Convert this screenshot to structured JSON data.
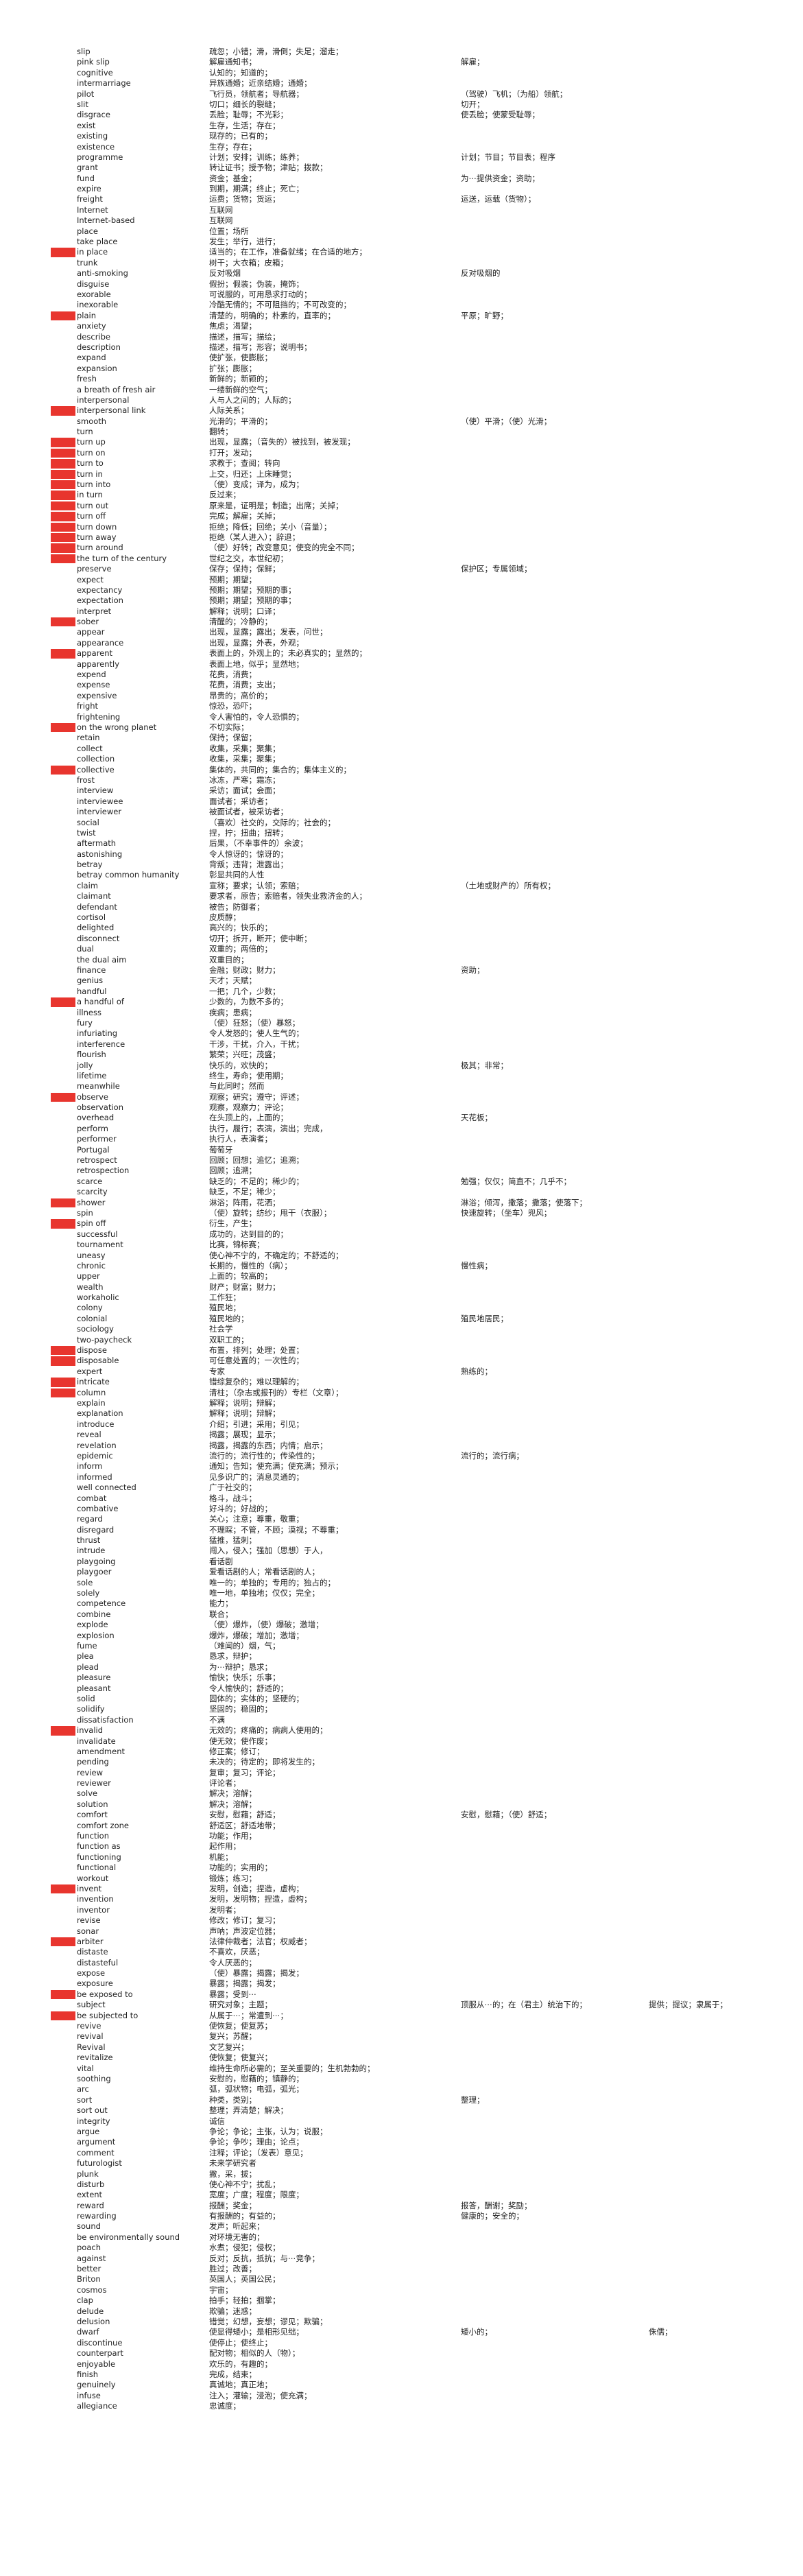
{
  "highlight_color": "#e8352e",
  "entries": [
    {
      "w": "slip",
      "d1": "疏忽；小错；滑，滑倒；失足；溜走；"
    },
    {
      "w": "pink slip",
      "d1": "解雇通知书；",
      "d2": "解雇；"
    },
    {
      "w": "cognitive",
      "d1": "认知的；知道的；"
    },
    {
      "w": "intermarriage",
      "d1": "异族通婚；近亲结婚；通婚；"
    },
    {
      "w": "pilot",
      "d1": "飞行员，领航者；导航器；",
      "d2": "（驾驶）飞机；（为船）领航；"
    },
    {
      "w": "slit",
      "d1": "切口；细长的裂缝；",
      "d2": "切开；"
    },
    {
      "w": "disgrace",
      "d1": "丢脸；耻辱；不光彩；",
      "d2": "使丢脸；使蒙受耻辱；"
    },
    {
      "w": "exist",
      "d1": "生存，生活；存在；"
    },
    {
      "w": "existing",
      "d1": "现存的；已有的；"
    },
    {
      "w": "existence",
      "d1": "生存；存在；"
    },
    {
      "w": "programme",
      "d1": "计划；安排；训练；练养；",
      "d2": "计划；节目；节目表；程序"
    },
    {
      "w": "grant",
      "d1": "转让证书；授予物；津贴；拨款；"
    },
    {
      "w": "fund",
      "d1": "资金；基金；",
      "d2": "为⋯提供资金；资助；"
    },
    {
      "w": "expire",
      "d1": "到期，期满；终止；死亡；"
    },
    {
      "w": "freight",
      "d1": "运费；货物；货运；",
      "d2": "运送，运载（货物）；"
    },
    {
      "w": "Internet",
      "d1": "互联网"
    },
    {
      "w": "Internet-based",
      "d1": "互联网"
    },
    {
      "w": "place",
      "d1": "位置；场所"
    },
    {
      "w": "take place",
      "d1": "发生；举行，进行；"
    },
    {
      "w": "in place",
      "d1": "适当的；在工作，准备就绪；在合适的地方；",
      "hl": true
    },
    {
      "w": "trunk",
      "d1": "树干；大衣箱；皮箱；"
    },
    {
      "w": "anti-smoking",
      "d1": "反对吸烟",
      "d2": "反对吸烟的"
    },
    {
      "w": "disguise",
      "d1": "假扮；假装；伪装，掩饰；"
    },
    {
      "w": "exorable",
      "d1": "可说服的，可用恳求打动的；"
    },
    {
      "w": "inexorable",
      "d1": "冷酷无情的；不可阻挡的；不可改变的；"
    },
    {
      "w": "plain",
      "d1": "清楚的，明确的；朴素的，直率的；",
      "d2": "平原；旷野；",
      "hl": true
    },
    {
      "w": "anxiety",
      "d1": "焦虑；渴望；"
    },
    {
      "w": "describe",
      "d1": "描述，描写；描绘；"
    },
    {
      "w": "description",
      "d1": "描述，描写；形容；说明书；"
    },
    {
      "w": "expand",
      "d1": "使扩张，使膨胀；"
    },
    {
      "w": "expansion",
      "d1": "扩张；膨胀；"
    },
    {
      "w": "fresh",
      "d1": "新鲜的；新颖的；"
    },
    {
      "w": "a breath of fresh air",
      "d1": "一缕新鲜的空气；"
    },
    {
      "w": "interpersonal",
      "d1": "人与人之间的；人际的；"
    },
    {
      "w": "interpersonal link",
      "d1": "人际关系；",
      "hl": true
    },
    {
      "w": "smooth",
      "d1": "光滑的；平滑的；",
      "d2": "（使）平滑；（使）光滑；"
    },
    {
      "w": "turn",
      "d1": "翻转；"
    },
    {
      "w": "turn up",
      "d1": "出现，显露；（音失的）被找到，被发现；",
      "hl": true
    },
    {
      "w": "turn on",
      "d1": "打开；发动；",
      "hl": true
    },
    {
      "w": "turn to",
      "d1": "求教于；查阅；转向",
      "hl": true
    },
    {
      "w": "turn in",
      "d1": "上交，归还；上床睡觉；",
      "hl": true
    },
    {
      "w": "turn into",
      "d1": "（使）变成；译为，成为；",
      "hl": true
    },
    {
      "w": "in turn",
      "d1": "反过来；",
      "hl": true
    },
    {
      "w": "turn out",
      "d1": "原来是，证明是；制造；出席；关掉；",
      "hl": true
    },
    {
      "w": "turn off",
      "d1": "完成；解雇；关掉；",
      "hl": true
    },
    {
      "w": "turn down",
      "d1": "拒绝；降低；回绝；关小（音量）；",
      "hl": true
    },
    {
      "w": "turn away",
      "d1": "拒绝（某人进入）；辞退；",
      "hl": true
    },
    {
      "w": "turn around",
      "d1": "（使）好转；改变意见；使变的完全不同；",
      "hl": true
    },
    {
      "w": "the turn of the century",
      "d1": "世纪之交，本世纪初；",
      "hl": true
    },
    {
      "w": "preserve",
      "d1": "保存；保持；保鲜；",
      "d2": "保护区；专属领域；"
    },
    {
      "w": "expect",
      "d1": "预期；期望；"
    },
    {
      "w": "expectancy",
      "d1": "预期；期望；预期的事；"
    },
    {
      "w": "expectation",
      "d1": "预期；期望；预期的事；"
    },
    {
      "w": "interpret",
      "d1": "解释；说明；口译；"
    },
    {
      "w": "sober",
      "d1": "清醒的；冷静的；",
      "hl": true
    },
    {
      "w": "appear",
      "d1": "出现，显露；露出；发表，问世；"
    },
    {
      "w": "appearance",
      "d1": "出现，显露；外表，外观；"
    },
    {
      "w": "apparent",
      "d1": "表面上的，外观上的；未必真实的；显然的；",
      "hl": true
    },
    {
      "w": "apparently",
      "d1": "表面上地，似乎；显然地；"
    },
    {
      "w": "expend",
      "d1": "花费，消费；"
    },
    {
      "w": "expense",
      "d1": "花费，消费；支出；"
    },
    {
      "w": "expensive",
      "d1": "昂贵的；高价的；"
    },
    {
      "w": "fright",
      "d1": "惊恐，恐吓；"
    },
    {
      "w": "frightening",
      "d1": "令人害怕的，令人恐惧的；"
    },
    {
      "w": "on the wrong planet",
      "d1": "不切实际；",
      "hl": true
    },
    {
      "w": "retain",
      "d1": "保持；保留；"
    },
    {
      "w": "collect",
      "d1": "收集，采集；聚集；"
    },
    {
      "w": "collection",
      "d1": "收集，采集；聚集；"
    },
    {
      "w": "collective",
      "d1": "集体的，共同的；集合的；集体主义的；",
      "hl": true
    },
    {
      "w": "frost",
      "d1": "冰冻，严寒；霜冻；"
    },
    {
      "w": "interview",
      "d1": "采访；面试；会面；"
    },
    {
      "w": "interviewee",
      "d1": "面试者；采访者；"
    },
    {
      "w": "interviewer",
      "d1": "被面试者，被采访者；"
    },
    {
      "w": "social",
      "d1": "（喜欢）社交的，交际的；社会的；"
    },
    {
      "w": "twist",
      "d1": "捏，拧；扭曲；扭转；"
    },
    {
      "w": "aftermath",
      "d1": "后果，（不幸事件的）余波；"
    },
    {
      "w": "astonishing",
      "d1": "令人惊讶的；惊讶的；"
    },
    {
      "w": "betray",
      "d1": "背叛；违背；泄露出；"
    },
    {
      "w": "betray common humanity",
      "d1": "彰显共同的人性"
    },
    {
      "w": "claim",
      "d1": "宣称；要求；认领；索赔；",
      "d2": "（土地或财产的）所有权；"
    },
    {
      "w": "claimant",
      "d1": "要求者，原告；索赔者，领失业救济金的人；"
    },
    {
      "w": "defendant",
      "d1": "被告；防御者；"
    },
    {
      "w": "cortisol",
      "d1": "皮质醇；"
    },
    {
      "w": "delighted",
      "d1": "高兴的；快乐的；"
    },
    {
      "w": "disconnect",
      "d1": "切开；拆开，断开；使中断；"
    },
    {
      "w": "dual",
      "d1": "双重的；两倍的；"
    },
    {
      "w": "the dual aim",
      "d1": "双重目的；"
    },
    {
      "w": "finance",
      "d1": "金融；财政；财力；",
      "d2": "资助；"
    },
    {
      "w": "genius",
      "d1": "天才；天赋；"
    },
    {
      "w": "handful",
      "d1": "一把；几个，少数；"
    },
    {
      "w": "a handful of",
      "d1": "少数的，为数不多的；",
      "hl": true
    },
    {
      "w": "illness",
      "d1": "疾病；患病；"
    },
    {
      "w": "fury",
      "d1": "（使）狂怒；（使）暴怒；"
    },
    {
      "w": "infuriating",
      "d1": "令人发怒的；使人生气的；"
    },
    {
      "w": "interference",
      "d1": "干涉，干扰，介入，干扰；"
    },
    {
      "w": "flourish",
      "d1": "繁荣；兴旺；茂盛；"
    },
    {
      "w": "jolly",
      "d1": "快乐的，欢快的；",
      "d2": "极其；非常；"
    },
    {
      "w": "lifetime",
      "d1": "终生，寿命；使用期；"
    },
    {
      "w": "meanwhile",
      "d1": "与此同时；然而"
    },
    {
      "w": "observe",
      "d1": "观察；研究；遵守；评述；",
      "hl": true
    },
    {
      "w": "observation",
      "d1": "观察，观察力；评论；"
    },
    {
      "w": "overhead",
      "d1": "在头顶上的，上面的；",
      "d2": "天花板；"
    },
    {
      "w": "perform",
      "d1": "执行，履行；表演，演出；完成，"
    },
    {
      "w": "performer",
      "d1": "执行人，表演者；"
    },
    {
      "w": "Portugal",
      "d1": "葡萄牙"
    },
    {
      "w": "retrospect",
      "d1": "回顾；回想；追忆；追溯；"
    },
    {
      "w": "retrospection",
      "d1": "回顾；追溯；"
    },
    {
      "w": "scarce",
      "d1": "缺乏的；不足的；稀少的；",
      "d2": "勉强；仅仅；简直不；几乎不；"
    },
    {
      "w": "scarcity",
      "d1": "缺乏，不足；稀少；"
    },
    {
      "w": "shower",
      "d1": "淋浴；阵雨，花洒；",
      "d2": "淋浴；倾泻，撒落；撒落；使落下；",
      "hl": true
    },
    {
      "w": "spin",
      "d1": "（使）旋转；纺纱；甩干（衣服）；",
      "d2": "快速旋转；（坐车）兜风；"
    },
    {
      "w": "spin off",
      "d1": "衍生，产生；",
      "hl": true
    },
    {
      "w": "successful",
      "d1": "成功的，达到目的的；"
    },
    {
      "w": "tournament",
      "d1": "比赛，锦标赛；"
    },
    {
      "w": "uneasy",
      "d1": "使心神不宁的，不确定的；不舒适的；"
    },
    {
      "w": "chronic",
      "d1": "长期的，慢性的（病）；",
      "d2": "慢性病；"
    },
    {
      "w": "upper",
      "d1": "上面的；较高的；"
    },
    {
      "w": "wealth",
      "d1": "财产；财富；财力；"
    },
    {
      "w": "workaholic",
      "d1": "工作狂；"
    },
    {
      "w": "colony",
      "d1": "殖民地；"
    },
    {
      "w": "colonial",
      "d1": "殖民地的；",
      "d2": "殖民地居民；"
    },
    {
      "w": "sociology",
      "d1": "社会学"
    },
    {
      "w": "two-paycheck",
      "d1": "双职工的；"
    },
    {
      "w": "dispose",
      "d1": "布置，排列；处理；处置；",
      "hl": true
    },
    {
      "w": "disposable",
      "d1": "可任意处置的；一次性的；",
      "hl": true
    },
    {
      "w": "expert",
      "d1": "专家",
      "d2": "熟练的；"
    },
    {
      "w": "intricate",
      "d1": "错综复杂的；难以理解的；",
      "hl": true
    },
    {
      "w": "column",
      "d1": "清柱；（杂志或报刊的）专栏（文章）；",
      "hl": true
    },
    {
      "w": "explain",
      "d1": "解释；说明；辩解；"
    },
    {
      "w": "explanation",
      "d1": "解释；说明；辩解；"
    },
    {
      "w": "introduce",
      "d1": "介绍；引进；采用；引见；"
    },
    {
      "w": "reveal",
      "d1": "揭露；展现；显示；"
    },
    {
      "w": "revelation",
      "d1": "揭露，揭露的东西；内情；启示；"
    },
    {
      "w": "epidemic",
      "d1": "流行的；流行性的；传染性的；",
      "d2": "流行的；流行病；"
    },
    {
      "w": "inform",
      "d1": "通知；告知；使充满；使充满；预示；"
    },
    {
      "w": "informed",
      "d1": "见多识广的；消息灵通的；"
    },
    {
      "w": "well connected",
      "d1": "广于社交的；"
    },
    {
      "w": "combat",
      "d1": "格斗，战斗；"
    },
    {
      "w": "combative",
      "d1": "好斗的；好战的；"
    },
    {
      "w": "regard",
      "d1": "关心；注意；尊重，敬重；"
    },
    {
      "w": "disregard",
      "d1": "不理睬；不管，不顾；漠视；不尊重；"
    },
    {
      "w": "thrust",
      "d1": "猛推，猛刺；"
    },
    {
      "w": "intrude",
      "d1": "闯入，侵入；强加（思想）于人，"
    },
    {
      "w": "playgoing",
      "d1": "看话剧"
    },
    {
      "w": "playgoer",
      "d1": "爱看话剧的人；常看话剧的人；"
    },
    {
      "w": "sole",
      "d1": "唯一的；单独的；专用的；独占的；"
    },
    {
      "w": "solely",
      "d1": "唯一地，单独地；仅仅；完全；"
    },
    {
      "w": "competence",
      "d1": "能力；"
    },
    {
      "w": "combine",
      "d1": "联合；"
    },
    {
      "w": "explode",
      "d1": "（使）爆炸，（使）爆破；激增；"
    },
    {
      "w": "explosion",
      "d1": "爆炸，爆破；增加；激增；"
    },
    {
      "w": "fume",
      "d1": "（难闻的）烟，气；"
    },
    {
      "w": "plea",
      "d1": "恳求，辩护；"
    },
    {
      "w": "plead",
      "d1": "为⋯辩护；恳求；"
    },
    {
      "w": "pleasure",
      "d1": "愉快；快乐；乐事；"
    },
    {
      "w": "pleasant",
      "d1": "令人愉快的；舒适的；"
    },
    {
      "w": "solid",
      "d1": "固体的；实体的；坚硬的；"
    },
    {
      "w": "solidify",
      "d1": "坚固的；稳固的；"
    },
    {
      "w": "dissatisfaction",
      "d1": "不满"
    },
    {
      "w": "invalid",
      "d1": "无效的；疼痛的；病病人使用的；",
      "hl": true
    },
    {
      "w": "invalidate",
      "d1": "使无效；使作废；"
    },
    {
      "w": "amendment",
      "d1": "修正案；修订；"
    },
    {
      "w": "pending",
      "d1": "未决的；待定的；即将发生的；"
    },
    {
      "w": "review",
      "d1": "复审；复习；评论；"
    },
    {
      "w": "reviewer",
      "d1": "评论者；"
    },
    {
      "w": "solve",
      "d1": "解决；溶解；"
    },
    {
      "w": "solution",
      "d1": "解决；溶解；"
    },
    {
      "w": "comfort",
      "d1": "安慰，慰藉；舒适；",
      "d2": "安慰，慰藉；（使）舒适；"
    },
    {
      "w": "comfort zone",
      "d1": "舒适区；舒适地带；"
    },
    {
      "w": "function",
      "d1": "功能；作用；"
    },
    {
      "w": "function as",
      "d1": "起作用；"
    },
    {
      "w": "functioning",
      "d1": "机能；"
    },
    {
      "w": "functional",
      "d1": "功能的；实用的；"
    },
    {
      "w": "workout",
      "d1": "锻炼；练习；"
    },
    {
      "w": "invent",
      "d1": "发明，创造；捏造，虚构；",
      "hl": true
    },
    {
      "w": "invention",
      "d1": "发明，发明物；捏造，虚构；"
    },
    {
      "w": "inventor",
      "d1": "发明者；"
    },
    {
      "w": "revise",
      "d1": "修改；修订；复习；"
    },
    {
      "w": "sonar",
      "d1": "声呐；声波定位器；"
    },
    {
      "w": "arbiter",
      "d1": "法律仲裁者；法官；权威者；",
      "hl": true
    },
    {
      "w": "distaste",
      "d1": "不喜欢，厌恶；"
    },
    {
      "w": "distasteful",
      "d1": "令人厌恶的；"
    },
    {
      "w": "expose",
      "d1": "（使）暴露；揭露；揭发；"
    },
    {
      "w": "exposure",
      "d1": "暴露；揭露；揭发；"
    },
    {
      "w": "be exposed to",
      "d1": "暴露；受到⋯",
      "hl": true
    },
    {
      "w": "subject",
      "d1": "研究对象；主题；",
      "d2": "顶服从⋯的；在（君主）统治下的；",
      "d3": "提供；提议；隶属于；"
    },
    {
      "w": "be subjected to",
      "d1": "从属于⋯；常遭到⋯；",
      "hl": true
    },
    {
      "w": "revive",
      "d1": "使恢复；使复苏；"
    },
    {
      "w": "revival",
      "d1": "复兴；苏醒；"
    },
    {
      "w": "Revival",
      "d1": "文艺复兴；"
    },
    {
      "w": "revitalize",
      "d1": "使恢复；使复兴；"
    },
    {
      "w": "vital",
      "d1": "维持生命所必需的；至关重要的；生机勃勃的；"
    },
    {
      "w": "soothing",
      "d1": "安慰的，慰藉的；镇静的；"
    },
    {
      "w": "arc",
      "d1": "弧，弧状物；电弧，弧光；"
    },
    {
      "w": "sort",
      "d1": "种类，类别；",
      "d2": "整理；"
    },
    {
      "w": "sort out",
      "d1": "整理；弄清楚；解决；"
    },
    {
      "w": "integrity",
      "d1": "诚信"
    },
    {
      "w": "argue",
      "d1": "争论；争论；主张，认为；说服；"
    },
    {
      "w": "argument",
      "d1": "争论；争吵；理由；论点；"
    },
    {
      "w": "comment",
      "d1": "注释；评论；（发表）意见；"
    },
    {
      "w": "futurologist",
      "d1": "未来学研究者"
    },
    {
      "w": "plunk",
      "d1": "撇，采，拔；"
    },
    {
      "w": "disturb",
      "d1": "使心神不宁；扰乱；"
    },
    {
      "w": "extent",
      "d1": "宽度；广度；程度；限度；"
    },
    {
      "w": "reward",
      "d1": "报酬；奖金；",
      "d2": "报答，酬谢；奖励；"
    },
    {
      "w": "rewarding",
      "d1": "有报酬的；有益的；",
      "d2": "健康的；安全的；"
    },
    {
      "w": "sound",
      "d1": "发声；听起来；"
    },
    {
      "w": "be environmentally sound",
      "d1": "对环境无害的；"
    },
    {
      "w": "poach",
      "d1": "水煮；侵犯；侵权；"
    },
    {
      "w": "against",
      "d1": "反对；反抗，抵抗；与⋯竞争；"
    },
    {
      "w": "better",
      "d1": "胜过；改善；"
    },
    {
      "w": "Briton",
      "d1": "英国人；英国公民；"
    },
    {
      "w": "cosmos",
      "d1": "宇宙；"
    },
    {
      "w": "clap",
      "d1": "拍手；轻拍；掴掌；"
    },
    {
      "w": "delude",
      "d1": "欺骗；迷惑；"
    },
    {
      "w": "delusion",
      "d1": "错觉；幻想，妄想；谬见；欺骗；"
    },
    {
      "w": "dwarf",
      "d1": "使显得矮小；是相形见绌；",
      "d2": "矮小的；",
      "d3": "侏儒；"
    },
    {
      "w": "discontinue",
      "d1": "使停止；使终止；"
    },
    {
      "w": "counterpart",
      "d1": "配对物；相似的人（物）；"
    },
    {
      "w": "enjoyable",
      "d1": "欢乐的，有趣的；"
    },
    {
      "w": "finish",
      "d1": "完成，结束；"
    },
    {
      "w": "genuinely",
      "d1": "真诚地；真正地；"
    },
    {
      "w": "infuse",
      "d1": "注入；灌输；浸泡；使充满；"
    },
    {
      "w": "allegiance",
      "d1": "忠诚度；"
    }
  ]
}
